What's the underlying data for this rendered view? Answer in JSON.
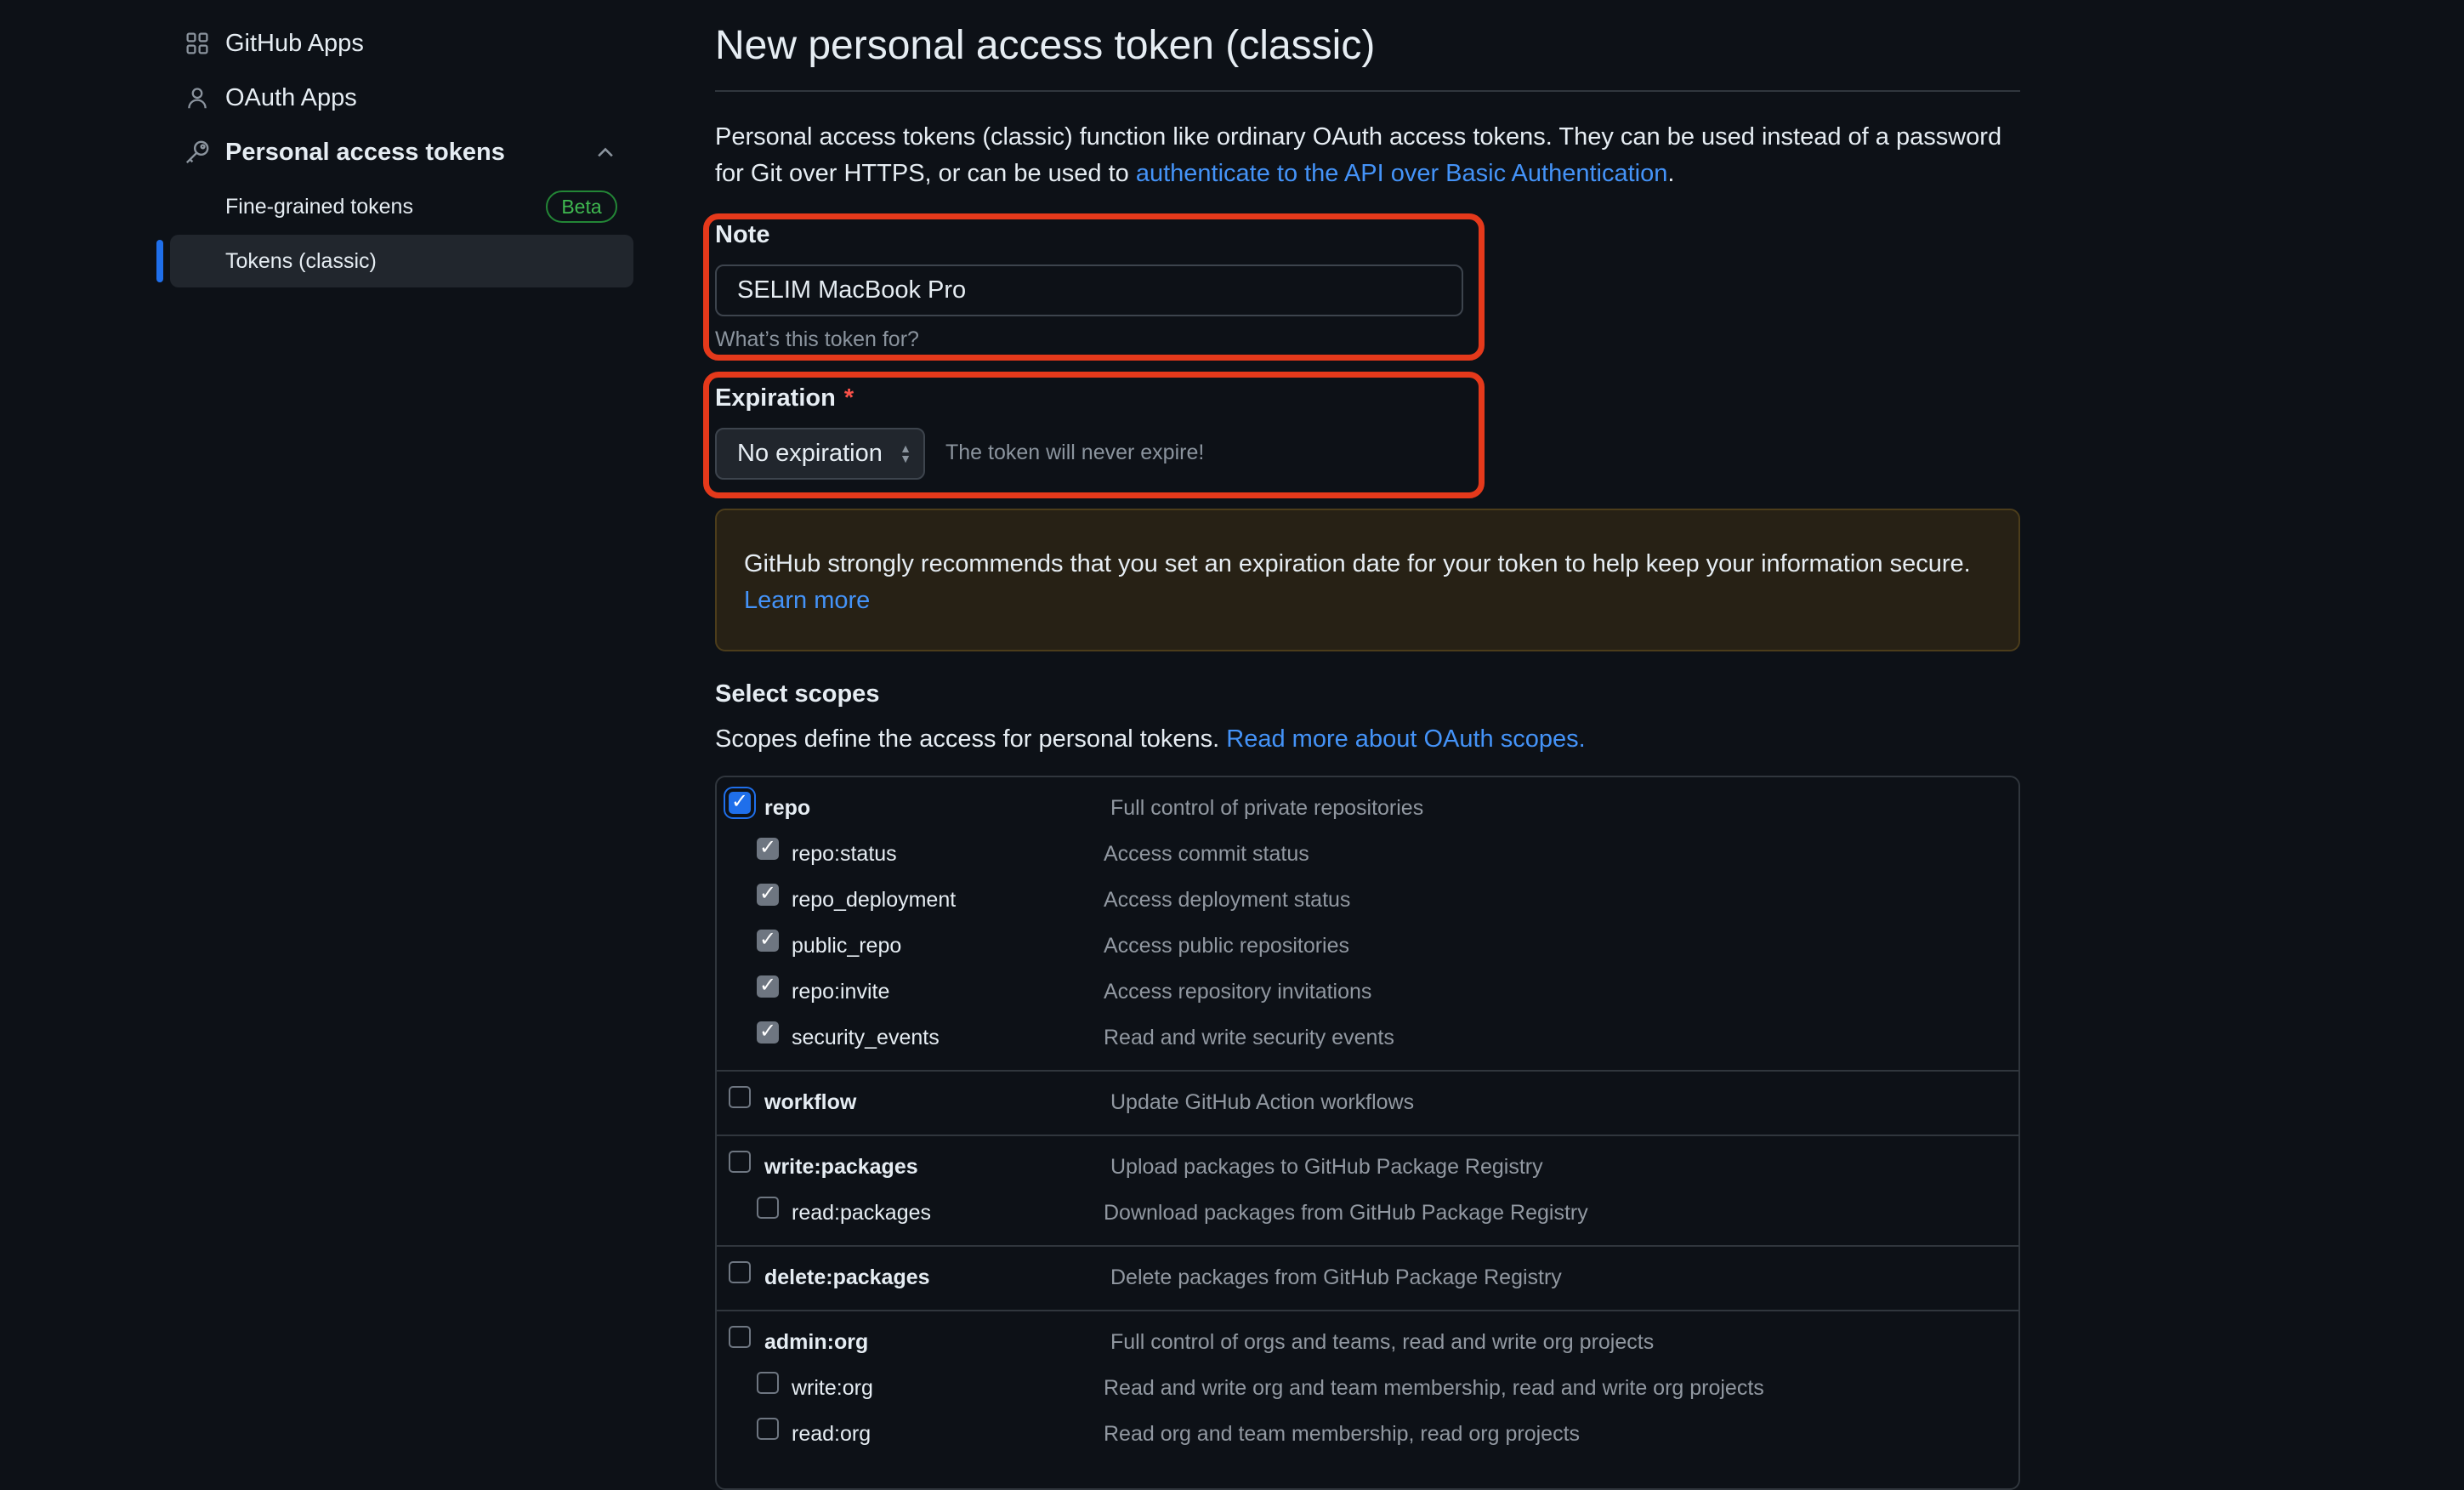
{
  "sidebar": {
    "items": [
      {
        "label": "GitHub Apps",
        "icon": "apps-grid-icon"
      },
      {
        "label": "OAuth Apps",
        "icon": "person-icon"
      },
      {
        "label": "Personal access tokens",
        "icon": "key-icon",
        "expanded": true
      }
    ],
    "subitems": [
      {
        "label": "Fine-grained tokens",
        "badge": "Beta"
      },
      {
        "label": "Tokens (classic)",
        "active": true
      }
    ]
  },
  "page": {
    "title": "New personal access token (classic)",
    "intro_text": "Personal access tokens (classic) function like ordinary OAuth access tokens. They can be used instead of a password for Git over HTTPS, or can be used to ",
    "intro_link": "authenticate to the API over Basic Authentication",
    "intro_end": "."
  },
  "note": {
    "label": "Note",
    "value": "SELIM MacBook Pro",
    "hint": "What’s this token for?"
  },
  "expiration": {
    "label": "Expiration",
    "required_mark": "*",
    "selected": "No expiration",
    "hint": "The token will never expire!"
  },
  "warning": {
    "text": "GitHub strongly recommends that you set an expiration date for your token to help keep your information secure.",
    "link": "Learn more"
  },
  "scopes": {
    "title": "Select scopes",
    "description": "Scopes define the access for personal tokens. ",
    "link": "Read more about OAuth scopes.",
    "rows": [
      {
        "name": "repo",
        "desc": "Full control of private repositories",
        "checked": true,
        "parent": true
      },
      {
        "name": "repo:status",
        "desc": "Access commit status",
        "checked": true,
        "parent": false
      },
      {
        "name": "repo_deployment",
        "desc": "Access deployment status",
        "checked": true,
        "parent": false
      },
      {
        "name": "public_repo",
        "desc": "Access public repositories",
        "checked": true,
        "parent": false
      },
      {
        "name": "repo:invite",
        "desc": "Access repository invitations",
        "checked": true,
        "parent": false
      },
      {
        "name": "security_events",
        "desc": "Read and write security events",
        "checked": true,
        "parent": false
      },
      {
        "name": "workflow",
        "desc": "Update GitHub Action workflows",
        "checked": false,
        "parent": true
      },
      {
        "name": "write:packages",
        "desc": "Upload packages to GitHub Package Registry",
        "checked": false,
        "parent": true
      },
      {
        "name": "read:packages",
        "desc": "Download packages from GitHub Package Registry",
        "checked": false,
        "parent": false
      },
      {
        "name": "delete:packages",
        "desc": "Delete packages from GitHub Package Registry",
        "checked": false,
        "parent": true
      },
      {
        "name": "admin:org",
        "desc": "Full control of orgs and teams, read and write org projects",
        "checked": false,
        "parent": true
      },
      {
        "name": "write:org",
        "desc": "Read and write org and team membership, read and write org projects",
        "checked": false,
        "parent": false
      },
      {
        "name": "read:org",
        "desc": "Read org and team membership, read org projects",
        "checked": false,
        "parent": false
      }
    ]
  },
  "colors": {
    "background": "#0d1117",
    "accent": "#1f6feb",
    "link": "#4493f8",
    "highlight": "#e5391b",
    "beta": "#3fb950"
  }
}
